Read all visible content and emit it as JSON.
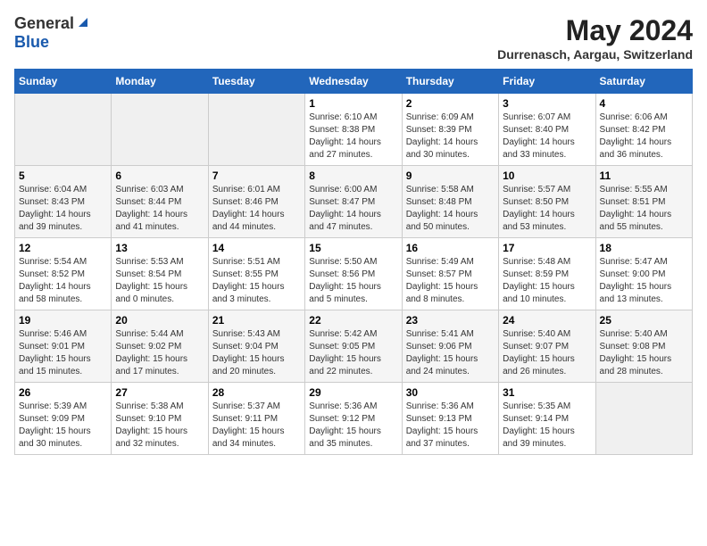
{
  "logo": {
    "general": "General",
    "blue": "Blue"
  },
  "title": "May 2024",
  "location": "Durrenasch, Aargau, Switzerland",
  "days_of_week": [
    "Sunday",
    "Monday",
    "Tuesday",
    "Wednesday",
    "Thursday",
    "Friday",
    "Saturday"
  ],
  "weeks": [
    [
      {
        "day": "",
        "info": ""
      },
      {
        "day": "",
        "info": ""
      },
      {
        "day": "",
        "info": ""
      },
      {
        "day": "1",
        "info": "Sunrise: 6:10 AM\nSunset: 8:38 PM\nDaylight: 14 hours\nand 27 minutes."
      },
      {
        "day": "2",
        "info": "Sunrise: 6:09 AM\nSunset: 8:39 PM\nDaylight: 14 hours\nand 30 minutes."
      },
      {
        "day": "3",
        "info": "Sunrise: 6:07 AM\nSunset: 8:40 PM\nDaylight: 14 hours\nand 33 minutes."
      },
      {
        "day": "4",
        "info": "Sunrise: 6:06 AM\nSunset: 8:42 PM\nDaylight: 14 hours\nand 36 minutes."
      }
    ],
    [
      {
        "day": "5",
        "info": "Sunrise: 6:04 AM\nSunset: 8:43 PM\nDaylight: 14 hours\nand 39 minutes."
      },
      {
        "day": "6",
        "info": "Sunrise: 6:03 AM\nSunset: 8:44 PM\nDaylight: 14 hours\nand 41 minutes."
      },
      {
        "day": "7",
        "info": "Sunrise: 6:01 AM\nSunset: 8:46 PM\nDaylight: 14 hours\nand 44 minutes."
      },
      {
        "day": "8",
        "info": "Sunrise: 6:00 AM\nSunset: 8:47 PM\nDaylight: 14 hours\nand 47 minutes."
      },
      {
        "day": "9",
        "info": "Sunrise: 5:58 AM\nSunset: 8:48 PM\nDaylight: 14 hours\nand 50 minutes."
      },
      {
        "day": "10",
        "info": "Sunrise: 5:57 AM\nSunset: 8:50 PM\nDaylight: 14 hours\nand 53 minutes."
      },
      {
        "day": "11",
        "info": "Sunrise: 5:55 AM\nSunset: 8:51 PM\nDaylight: 14 hours\nand 55 minutes."
      }
    ],
    [
      {
        "day": "12",
        "info": "Sunrise: 5:54 AM\nSunset: 8:52 PM\nDaylight: 14 hours\nand 58 minutes."
      },
      {
        "day": "13",
        "info": "Sunrise: 5:53 AM\nSunset: 8:54 PM\nDaylight: 15 hours\nand 0 minutes."
      },
      {
        "day": "14",
        "info": "Sunrise: 5:51 AM\nSunset: 8:55 PM\nDaylight: 15 hours\nand 3 minutes."
      },
      {
        "day": "15",
        "info": "Sunrise: 5:50 AM\nSunset: 8:56 PM\nDaylight: 15 hours\nand 5 minutes."
      },
      {
        "day": "16",
        "info": "Sunrise: 5:49 AM\nSunset: 8:57 PM\nDaylight: 15 hours\nand 8 minutes."
      },
      {
        "day": "17",
        "info": "Sunrise: 5:48 AM\nSunset: 8:59 PM\nDaylight: 15 hours\nand 10 minutes."
      },
      {
        "day": "18",
        "info": "Sunrise: 5:47 AM\nSunset: 9:00 PM\nDaylight: 15 hours\nand 13 minutes."
      }
    ],
    [
      {
        "day": "19",
        "info": "Sunrise: 5:46 AM\nSunset: 9:01 PM\nDaylight: 15 hours\nand 15 minutes."
      },
      {
        "day": "20",
        "info": "Sunrise: 5:44 AM\nSunset: 9:02 PM\nDaylight: 15 hours\nand 17 minutes."
      },
      {
        "day": "21",
        "info": "Sunrise: 5:43 AM\nSunset: 9:04 PM\nDaylight: 15 hours\nand 20 minutes."
      },
      {
        "day": "22",
        "info": "Sunrise: 5:42 AM\nSunset: 9:05 PM\nDaylight: 15 hours\nand 22 minutes."
      },
      {
        "day": "23",
        "info": "Sunrise: 5:41 AM\nSunset: 9:06 PM\nDaylight: 15 hours\nand 24 minutes."
      },
      {
        "day": "24",
        "info": "Sunrise: 5:40 AM\nSunset: 9:07 PM\nDaylight: 15 hours\nand 26 minutes."
      },
      {
        "day": "25",
        "info": "Sunrise: 5:40 AM\nSunset: 9:08 PM\nDaylight: 15 hours\nand 28 minutes."
      }
    ],
    [
      {
        "day": "26",
        "info": "Sunrise: 5:39 AM\nSunset: 9:09 PM\nDaylight: 15 hours\nand 30 minutes."
      },
      {
        "day": "27",
        "info": "Sunrise: 5:38 AM\nSunset: 9:10 PM\nDaylight: 15 hours\nand 32 minutes."
      },
      {
        "day": "28",
        "info": "Sunrise: 5:37 AM\nSunset: 9:11 PM\nDaylight: 15 hours\nand 34 minutes."
      },
      {
        "day": "29",
        "info": "Sunrise: 5:36 AM\nSunset: 9:12 PM\nDaylight: 15 hours\nand 35 minutes."
      },
      {
        "day": "30",
        "info": "Sunrise: 5:36 AM\nSunset: 9:13 PM\nDaylight: 15 hours\nand 37 minutes."
      },
      {
        "day": "31",
        "info": "Sunrise: 5:35 AM\nSunset: 9:14 PM\nDaylight: 15 hours\nand 39 minutes."
      },
      {
        "day": "",
        "info": ""
      }
    ]
  ]
}
